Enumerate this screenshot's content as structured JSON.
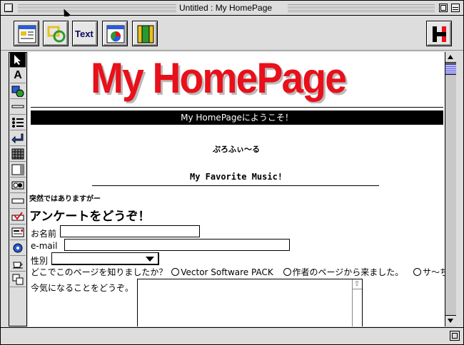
{
  "window": {
    "title": "Untitled : My HomePage"
  },
  "toolbar": {
    "buttons": [
      "page-icon",
      "link-icon",
      "text-icon",
      "chart-icon",
      "frame-icon"
    ],
    "text_button_label": "Text",
    "brand_button_label": "H"
  },
  "palette": {
    "text_tool_label": "A"
  },
  "page": {
    "logo_text": "My HomePage",
    "banner": "My HomePageにようこそ！",
    "profile": "ぷろふぃ〜る",
    "favorite_music": "My Favorite Music!",
    "sudden": "突然ではありますがー",
    "survey_title": "アンケートをどうぞ！",
    "name_label": "お名前",
    "email_label": "e-mail",
    "gender_label": "性別",
    "how_found_label": "どこでこのページを知りましたか？",
    "radio_options": [
      "Vector Software PACK",
      "作者のページから来ました。",
      "サ〜ち"
    ],
    "comment_label": "今気になることをどうぞ。",
    "name_value": "",
    "email_value": "",
    "gender_value": "",
    "comment_value": ""
  },
  "colors": {
    "logo": "#e8101a",
    "scroll_thumb": "#9999ff"
  }
}
